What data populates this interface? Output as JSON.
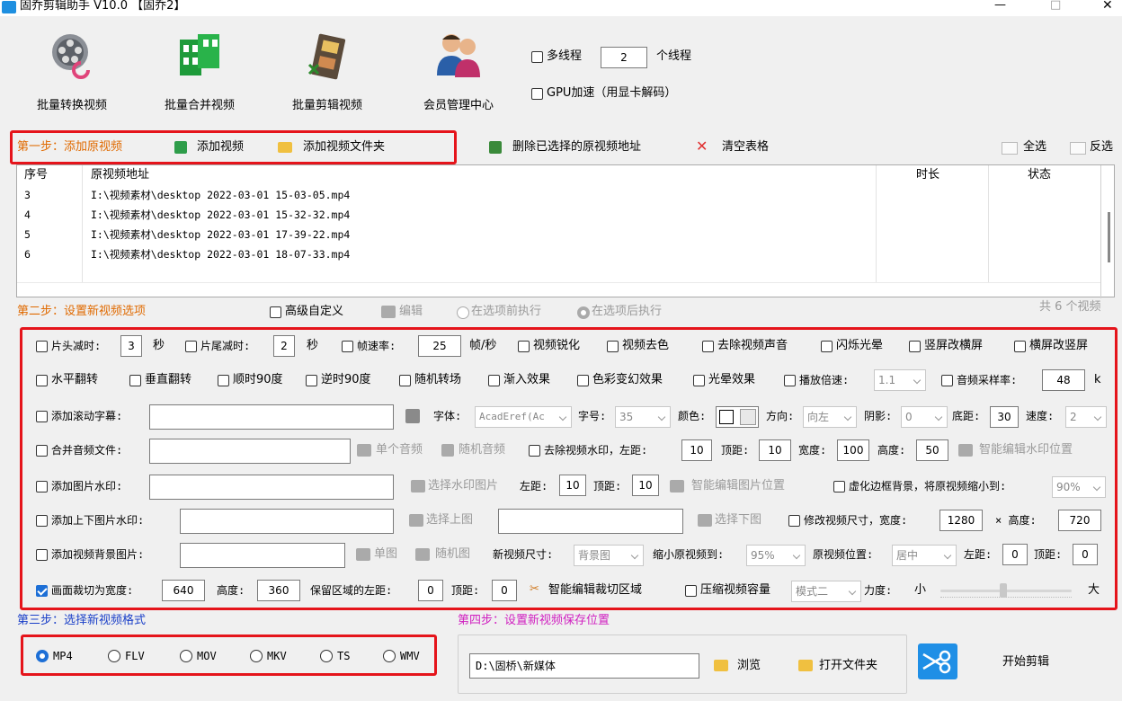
{
  "window": {
    "title": "固乔剪辑助手 V10.0 【固乔2】",
    "min": "—",
    "max": "□",
    "close": "✕"
  },
  "toolbar": {
    "convert": "批量转换视频",
    "merge": "批量合并视频",
    "cut": "批量剪辑视频",
    "member": "会员管理中心",
    "multithread": "多线程",
    "threads": "2",
    "threads_unit": "个线程",
    "gpu": "GPU加速（用显卡解码）"
  },
  "step1": {
    "label": "第一步：添加原视频",
    "add_video": "添加视频",
    "add_folder": "添加视频文件夹",
    "delete_selected": "删除已选择的原视频地址",
    "clear": "清空表格",
    "select_all": "全选",
    "invert": "反选"
  },
  "table": {
    "headers": {
      "index": "序号",
      "path": "原视频地址",
      "duration": "时长",
      "status": "状态"
    },
    "rows": [
      {
        "index": "3",
        "path": "I:\\视频素材\\desktop 2022-03-01 15-03-05.mp4",
        "duration": "",
        "status": ""
      },
      {
        "index": "4",
        "path": "I:\\视频素材\\desktop 2022-03-01 15-32-32.mp4",
        "duration": "",
        "status": ""
      },
      {
        "index": "5",
        "path": "I:\\视频素材\\desktop 2022-03-01 17-39-22.mp4",
        "duration": "",
        "status": ""
      },
      {
        "index": "6",
        "path": "I:\\视频素材\\desktop 2022-03-01 18-07-33.mp4",
        "duration": "",
        "status": ""
      }
    ]
  },
  "step2": {
    "label": "第二步：设置新视频选项",
    "advanced": "高级自定义",
    "edit": "编辑",
    "before": "在选项前执行",
    "after": "在选项后执行",
    "count": "共 6 个视频"
  },
  "opts": {
    "r1": {
      "head_cut": "片头减时:",
      "head_val": "3",
      "sec": "秒",
      "tail_cut": "片尾减时:",
      "tail_val": "2",
      "sec2": "秒",
      "fps": "帧速率:",
      "fps_val": "25",
      "fps_unit": "帧/秒",
      "sharpen": "视频锐化",
      "decolor": "视频去色",
      "mute": "去除视频声音",
      "flash": "闪烁光晕",
      "v2h": "竖屏改横屏",
      "h2v": "横屏改竖屏"
    },
    "r2": {
      "hflip": "水平翻转",
      "vflip": "垂直翻转",
      "cw": "顺时90度",
      "ccw": "逆时90度",
      "rand_trans": "随机转场",
      "fade": "渐入效果",
      "color_fx": "色彩变幻效果",
      "glow": "光晕效果",
      "speed": "播放倍速:",
      "speed_val": "1.1",
      "sample": "音频采样率:",
      "sample_val": "48",
      "sample_unit": "k"
    },
    "r3": {
      "scroll": "添加滚动字幕:",
      "font": "字体:",
      "font_val": "AcadEref(Ac",
      "size": "字号:",
      "size_val": "35",
      "color": "颜色:",
      "dir": "方向:",
      "dir_val": "向左",
      "shadow": "阴影:",
      "shadow_val": "0",
      "bottom": "底距:",
      "bottom_val": "30",
      "spd": "速度:",
      "spd_val": "2"
    },
    "r4": {
      "audio": "合并音频文件:",
      "single": "单个音频",
      "random": "随机音频",
      "wm": "去除视频水印，左距:",
      "left_val": "10",
      "top": "顶距:",
      "top_val": "10",
      "width": "宽度:",
      "width_val": "100",
      "height": "高度:",
      "height_val": "50",
      "smart": "智能编辑水印位置"
    },
    "r5": {
      "img_wm": "添加图片水印:",
      "choose": "选择水印图片",
      "left": "左距:",
      "left_val": "10",
      "top": "顶距:",
      "top_val": "10",
      "smart": "智能编辑图片位置",
      "blur": "虚化边框背景，将原视频缩小到:",
      "blur_val": "90%"
    },
    "r6": {
      "tb_wm": "添加上下图片水印:",
      "up": "选择上图",
      "down": "选择下图",
      "resize": "修改视频尺寸，宽度:",
      "w_val": "1280",
      "x": "× 高度:",
      "h_val": "720"
    },
    "r7": {
      "bg": "添加视频背景图片:",
      "single": "单图",
      "random": "随机图",
      "new_size": "新视频尺寸:",
      "new_size_val": "背景图",
      "shrink": "缩小原视频到:",
      "shrink_val": "95%",
      "pos": "原视频位置:",
      "pos_val": "居中",
      "left": "左距:",
      "left_val": "0",
      "top": "顶距:",
      "top_val": "0"
    },
    "r8": {
      "crop": "画面裁切为宽度:",
      "w_val": "640",
      "height": "高度:",
      "h_val": "360",
      "keep": "保留区域的左距:",
      "left_val": "0",
      "top": "顶距:",
      "top_val": "0",
      "smart": "智能编辑裁切区域",
      "compress": "压缩视频容量",
      "mode_val": "模式二",
      "force": "力度:",
      "small": "小",
      "big": "大",
      "force_level": 0.48
    }
  },
  "step3": {
    "label": "第三步：选择新视频格式",
    "formats": [
      "MP4",
      "FLV",
      "MOV",
      "MKV",
      "TS",
      "WMV"
    ]
  },
  "step4": {
    "label": "第四步：设置新视频保存位置",
    "path": "D:\\固桥\\新媒体",
    "browse": "浏览",
    "open": "打开文件夹",
    "start": "开始剪辑"
  }
}
